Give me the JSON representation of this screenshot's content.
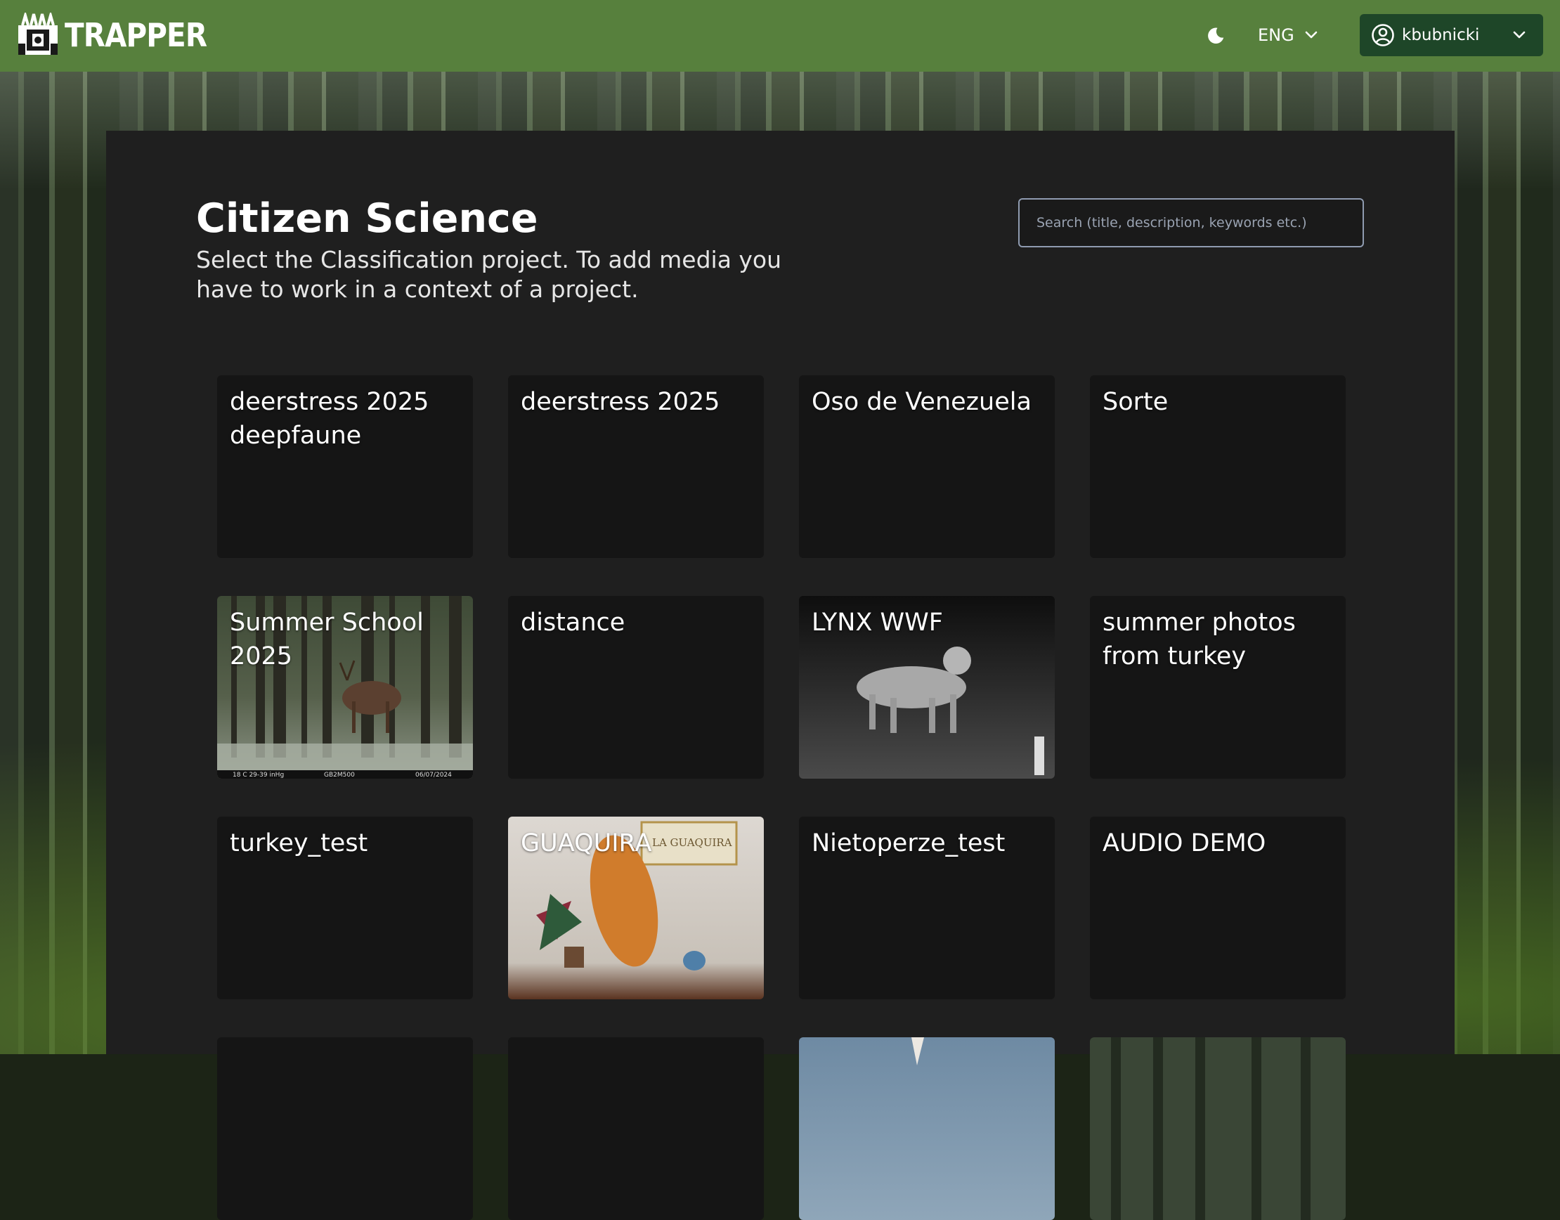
{
  "header": {
    "logo_text": "TRAPPER",
    "language": "ENG",
    "username": "kbubnicki",
    "icons": [
      "trapper-logo-icon",
      "moon-icon",
      "chevron-down-icon",
      "user-circle-icon"
    ]
  },
  "main": {
    "title": "Citizen Science",
    "subtitle": "Select the Classification project. To add media you have to work in a context of a project.",
    "search": {
      "placeholder": "Search (title, description, keywords etc.)",
      "value": ""
    },
    "projects": [
      {
        "title": "deerstress 2025 deepfaune",
        "thumbnail": "none"
      },
      {
        "title": "deerstress 2025",
        "thumbnail": "none"
      },
      {
        "title": "Oso de Venezuela",
        "thumbnail": "none"
      },
      {
        "title": "Sorte",
        "thumbnail": "none"
      },
      {
        "title": "Summer School 2025",
        "thumbnail": "forest-deer-photo",
        "overlay_text": [
          "18 C 29-39 inHg",
          "GB2M500",
          "06/07/2024"
        ]
      },
      {
        "title": "distance",
        "thumbnail": "none"
      },
      {
        "title": "LYNX WWF",
        "thumbnail": "night-lynx-photo"
      },
      {
        "title": "summer photos from turkey",
        "thumbnail": "none"
      },
      {
        "title": "turkey_test",
        "thumbnail": "none"
      },
      {
        "title": "GUAQUIRA",
        "thumbnail": "cacao-pod-photo",
        "overlay_text": [
          "LA GUAQUIRA"
        ]
      },
      {
        "title": "Nietoperze_test",
        "thumbnail": "none"
      },
      {
        "title": "AUDIO DEMO",
        "thumbnail": "none"
      },
      {
        "title": "",
        "thumbnail": "none"
      },
      {
        "title": "",
        "thumbnail": "none"
      },
      {
        "title": "",
        "thumbnail": "sky-photo"
      },
      {
        "title": "",
        "thumbnail": "forest-photo"
      }
    ]
  },
  "colors": {
    "header_bg": "#57803d",
    "user_button_bg": "#1e4628",
    "panel_bg": "#1f1f1f",
    "card_bg": "#151515",
    "text": "#ffffff"
  }
}
